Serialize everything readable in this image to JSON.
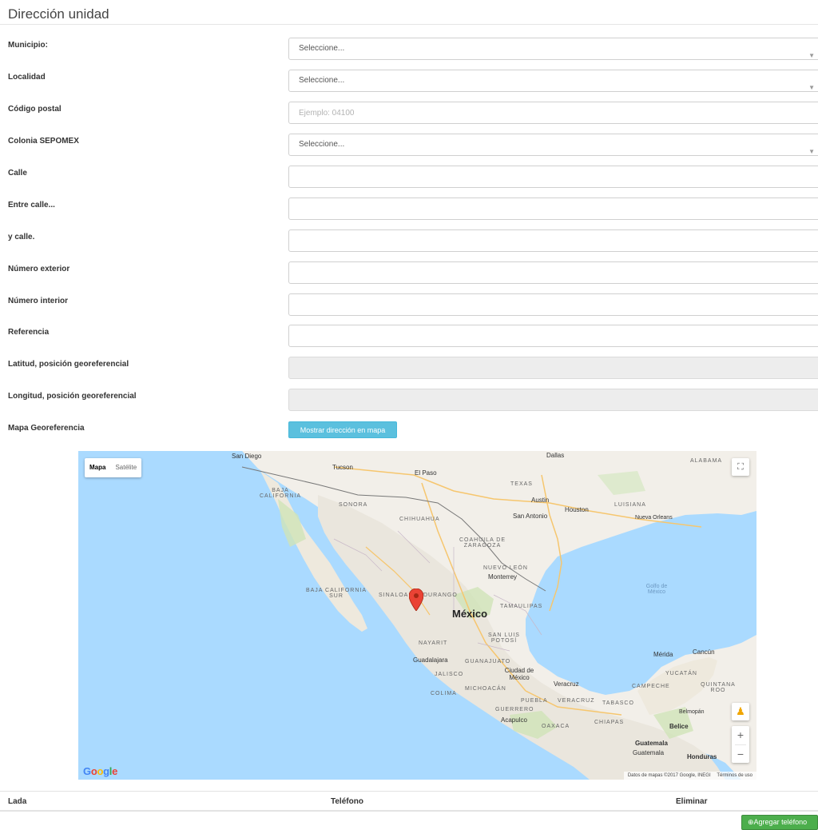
{
  "section": {
    "title": "Dirección unidad"
  },
  "form": {
    "municipio": {
      "label": "Municipio:",
      "value": "Seleccione..."
    },
    "localidad": {
      "label": "Localidad",
      "value": "Seleccione..."
    },
    "codigo_postal": {
      "label": "Código postal",
      "placeholder": "Ejemplo: 04100"
    },
    "colonia": {
      "label": "Colonia SEPOMEX",
      "value": "Seleccione..."
    },
    "calle": {
      "label": "Calle"
    },
    "entre_calle": {
      "label": "Entre calle..."
    },
    "y_calle": {
      "label": "y calle."
    },
    "numero_exterior": {
      "label": "Número exterior"
    },
    "numero_interior": {
      "label": "Número interior"
    },
    "referencia": {
      "label": "Referencia"
    },
    "latitud": {
      "label": "Latitud, posición georeferencial"
    },
    "longitud": {
      "label": "Longitud, posición georeferencial"
    },
    "mapa": {
      "label": "Mapa Georeferencia",
      "button": "Mostrar dirección en mapa"
    }
  },
  "map": {
    "type_buttons": [
      "Mapa",
      "Satélite"
    ],
    "labels": {
      "mexico": "México",
      "san_diego": "San Diego",
      "tucson": "Tucson",
      "el_paso": "El Paso",
      "dallas": "Dallas",
      "alabama": "ALABAMA",
      "baja_california": "BAJA CALIFORNIA",
      "sonora": "SONORA",
      "texas": "TEXAS",
      "austin": "Austin",
      "houston": "Houston",
      "luisiana": "LUISIANA",
      "san_antonio": "San Antonio",
      "nueva_orleans": "Nueva Orleans",
      "chihuahua": "CHIHUAHUA",
      "coahuila": "COAHUILA DE ZARAGOZA",
      "nuevo_leon": "NUEVO LEÓN",
      "monterrey": "Monterrey",
      "golfo": "Golfo de México",
      "baja_california_sur": "BAJA CALIFORNIA SUR",
      "sinaloa": "SINALOA",
      "durango": "DURANGO",
      "tamaulipas": "TAMAULIPAS",
      "san_luis_potosi": "SAN LUIS POTOSÍ",
      "nayarit": "NAYARIT",
      "guadalajara": "Guadalajara",
      "guanajuato": "GUANAJUATO",
      "jalisco": "JALISCO",
      "ciudad_de_mexico": "Ciudad de México",
      "merida": "Mérida",
      "cancun": "Cancún",
      "yucatan": "YUCATÁN",
      "quintana_roo": "QUINTANA ROO",
      "campeche": "CAMPECHE",
      "michoacan": "MICHOACÁN",
      "veracruz_city": "Veracruz",
      "colima": "COLIMA",
      "puebla": "PUEBLA",
      "veracruz": "VERACRUZ",
      "tabasco": "TABASCO",
      "guerrero": "GUERRERO",
      "acapulco": "Acapulco",
      "oaxaca": "OAXACA",
      "chiapas": "CHIAPAS",
      "belmopan": "Belmopán",
      "belice": "Belice",
      "guatemala": "Guatemala",
      "guatemala_city": "Guatemala",
      "honduras": "Honduras"
    },
    "attribution": "Datos de mapas ©2017 Google, INEGI",
    "terms": "Términos de uso",
    "logo": "Google",
    "colors": {
      "water": "#aadaff",
      "land": "#f2efe9",
      "marker": "#ea4335"
    }
  },
  "phones": {
    "columns": [
      "Lada",
      "Teléfono",
      "Eliminar"
    ],
    "add_button": "Agregar teléfono"
  }
}
